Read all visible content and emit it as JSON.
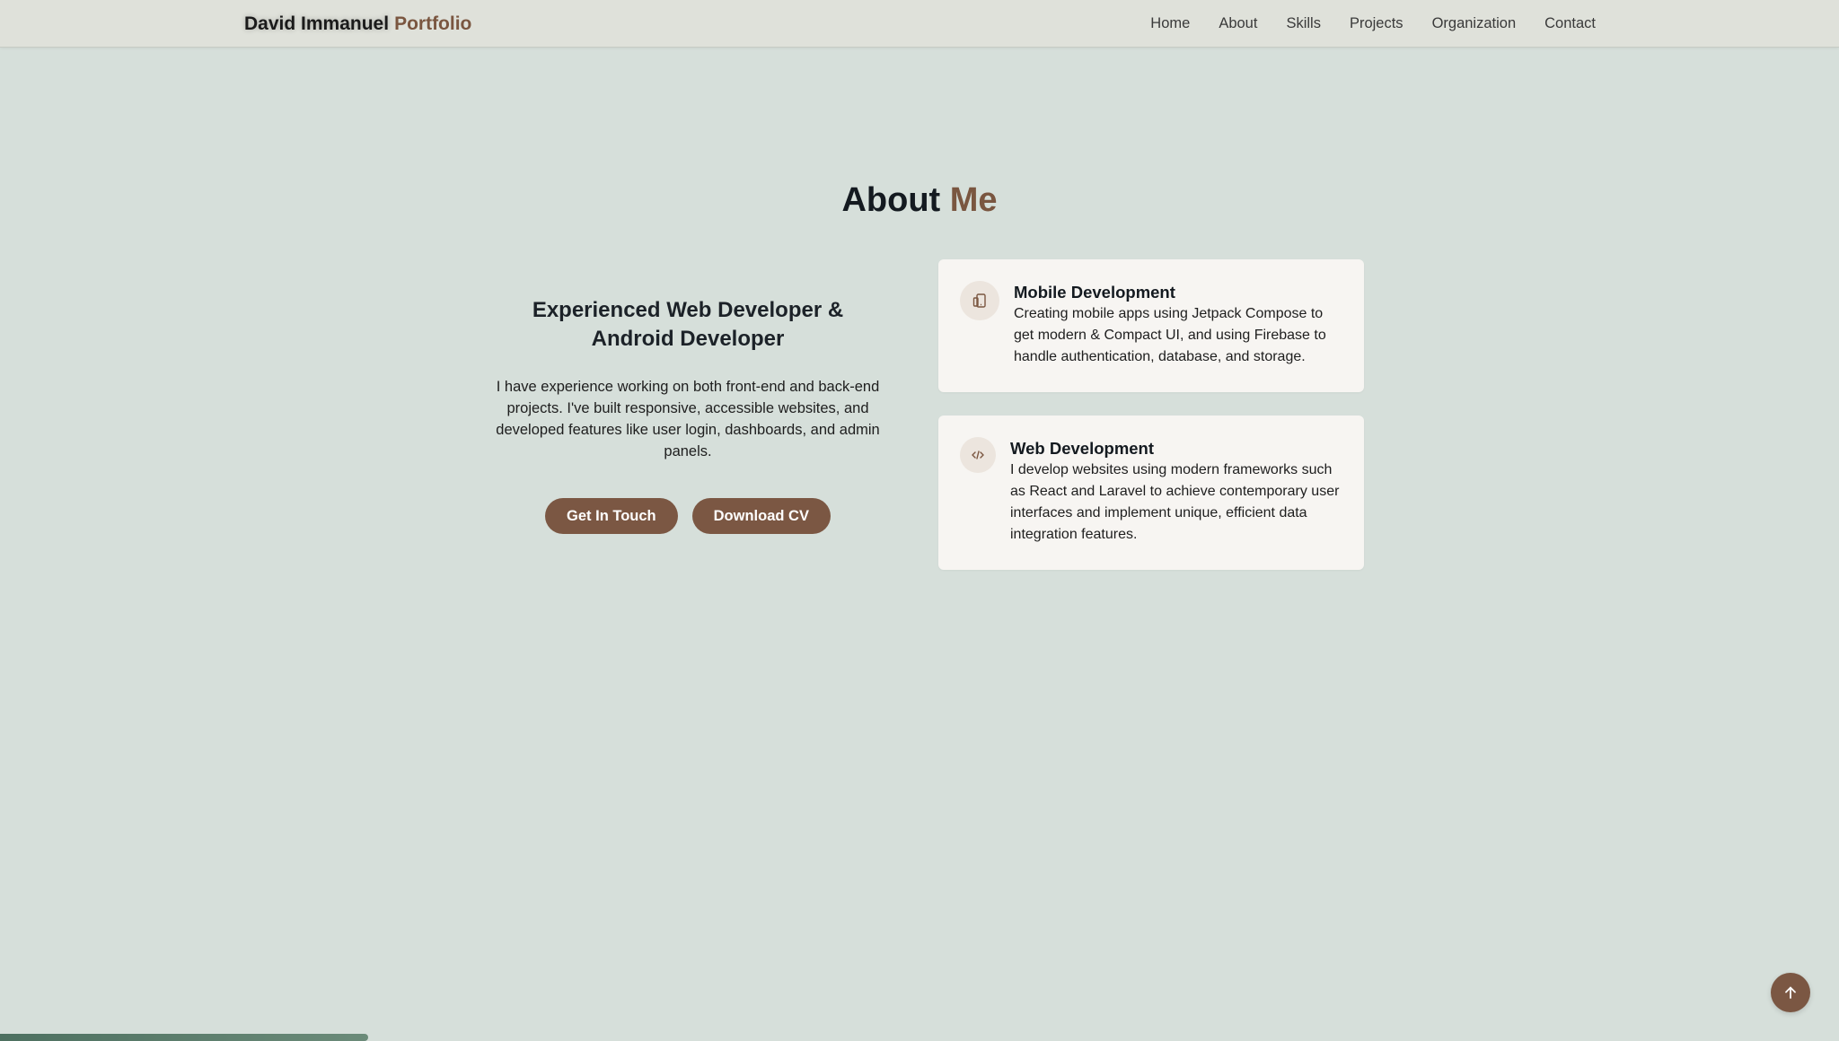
{
  "navbar": {
    "brand_name": "David Immanuel",
    "brand_accent": "Portfolio",
    "links": [
      "Home",
      "About",
      "Skills",
      "Projects",
      "Organization",
      "Contact"
    ]
  },
  "about": {
    "title_main": "About",
    "title_accent": "Me",
    "heading": "Experienced Web Developer & Android Developer",
    "description": "I have experience working on both front-end and back-end projects. I've built responsive, accessible websites, and developed features like user login, dashboards, and admin panels.",
    "buttons": {
      "get_in_touch": "Get In Touch",
      "download_cv": "Download CV"
    }
  },
  "cards": {
    "mobile": {
      "icon": "mobile-devices-icon",
      "title": "Mobile Development",
      "text": "Creating mobile apps using Jetpack Compose to get modern & Compact UI, and using Firebase to handle authentication, database, and storage."
    },
    "web": {
      "icon": "code-icon",
      "title": "Web Development",
      "text": "I develop websites using modern frameworks such as React and Laravel to achieve contemporary user interfaces and implement unique, efficient data integration features."
    }
  },
  "scroll_progress": 0.2,
  "colors": {
    "accent": "#7a5640",
    "background": "#d6dfda",
    "card": "#f7f5f2",
    "progress": "#5a7b6a"
  }
}
